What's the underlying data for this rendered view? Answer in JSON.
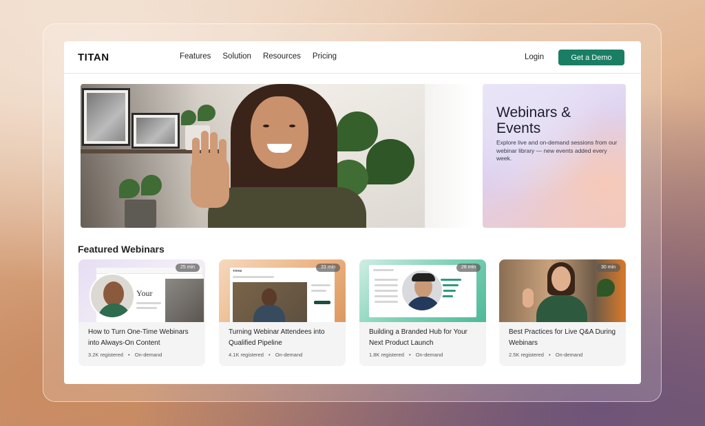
{
  "header": {
    "logo": "TITAN",
    "nav": [
      "Features",
      "Solution",
      "Resources",
      "Pricing"
    ],
    "login_label": "Login",
    "demo_label": "Get a Demo"
  },
  "promo": {
    "title": "Webinars & Events",
    "description": "Explore live and on-demand sessions from our webinar library — new events added every week."
  },
  "featured": {
    "title": "Featured Webinars",
    "cards": [
      {
        "title": "How to Turn One-Time Webinars into Always-On Content",
        "registered": "3.2K registered",
        "status": "On-demand",
        "duration": "25 min",
        "thumb_text": "Your"
      },
      {
        "title": "Turning Webinar Attendees into Qualified Pipeline",
        "registered": "4.1K registered",
        "status": "On-demand",
        "duration": "33 min",
        "thumb_text": "TITAN"
      },
      {
        "title": "Building a Branded Hub for Your Next Product Launch",
        "registered": "1.8K registered",
        "status": "On-demand",
        "duration": "28 min"
      },
      {
        "title": "Best Practices for Live Q&A During Webinars",
        "registered": "2.5K registered",
        "status": "On-demand",
        "duration": "30 min"
      }
    ],
    "separator": "•"
  },
  "colors": {
    "accent": "#1a7e64",
    "card_bg": "#f4f4f4"
  }
}
